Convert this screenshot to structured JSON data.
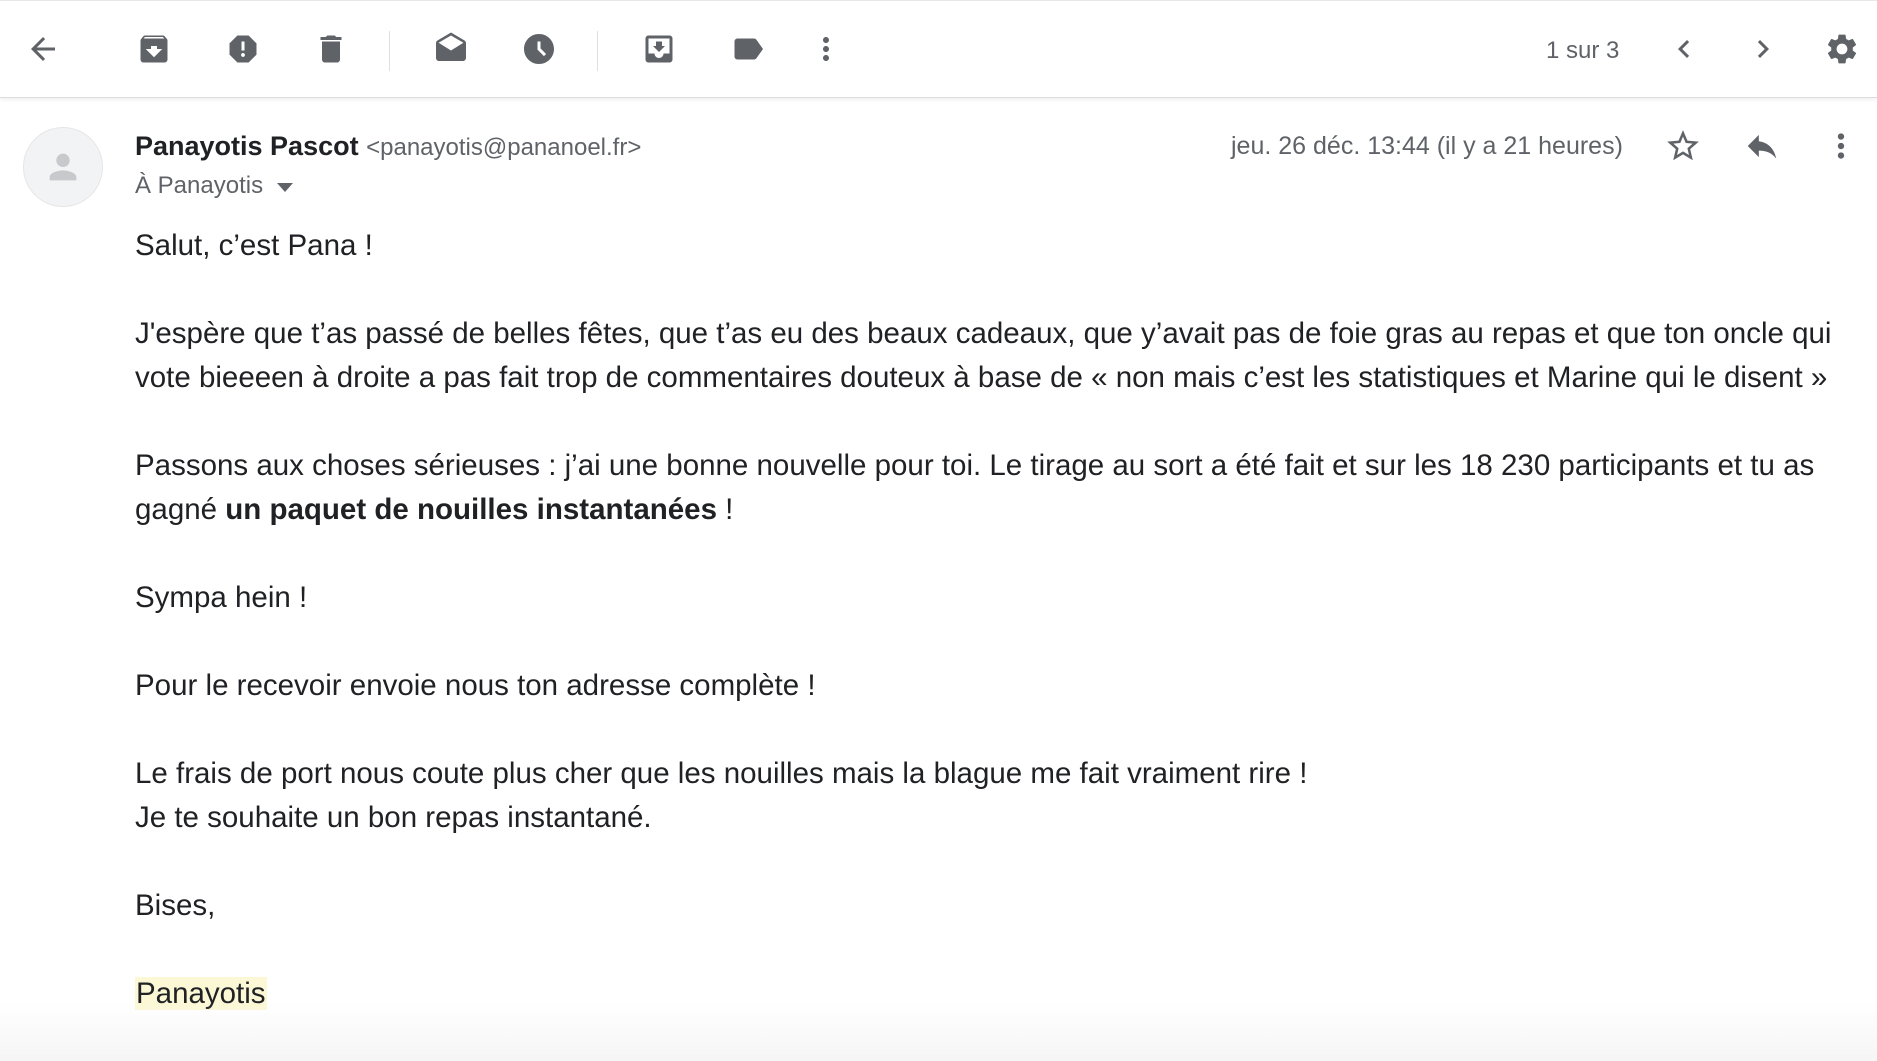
{
  "toolbar": {
    "pager": "1 sur 3",
    "icons": [
      "back-arrow-icon",
      "archive-icon",
      "report-spam-icon",
      "delete-icon",
      "mark-unread-icon",
      "snooze-icon",
      "move-to-icon",
      "label-icon",
      "more-vert-icon",
      "chevron-left-icon",
      "chevron-right-icon",
      "settings-gear-icon"
    ]
  },
  "message": {
    "sender_name": "Panayotis Pascot",
    "sender_email": "<panayotis@pananoel.fr>",
    "recipient": "À Panayotis",
    "date": "jeu. 26 déc. 13:44 (il y a 21 heures)",
    "body": {
      "greeting": "Salut, c’est Pana !",
      "para1": "J'espère que t’as passé de belles fêtes, que t’as eu des beaux cadeaux, que y’avait pas de foie gras au repas et que ton oncle qui vote bieeeen à droite a pas fait trop de commentaires douteux à base de « non mais c’est les statistiques et Marine qui le disent »",
      "para2_start": "Passons aux choses sérieuses : j’ai une bonne nouvelle pour toi. Le tirage au sort a été fait et sur les 18 230 participants et tu as gagné ",
      "para2_bold": "un paquet de nouilles instantanées",
      "para2_end": " !",
      "para3": "Sympa hein !",
      "para4": "Pour le recevoir envoie nous ton adresse complète !",
      "para5_line1": "Le frais de port nous coute plus cher que les nouilles mais la blague me fait vraiment rire !",
      "para5_line2": "Je te souhaite un bon repas instantané.",
      "closing": "Bises,",
      "signature": "Panayotis"
    }
  },
  "colors": {
    "icon": "#5f6368",
    "text": "#202124",
    "highlight": "#fcf8d6"
  }
}
